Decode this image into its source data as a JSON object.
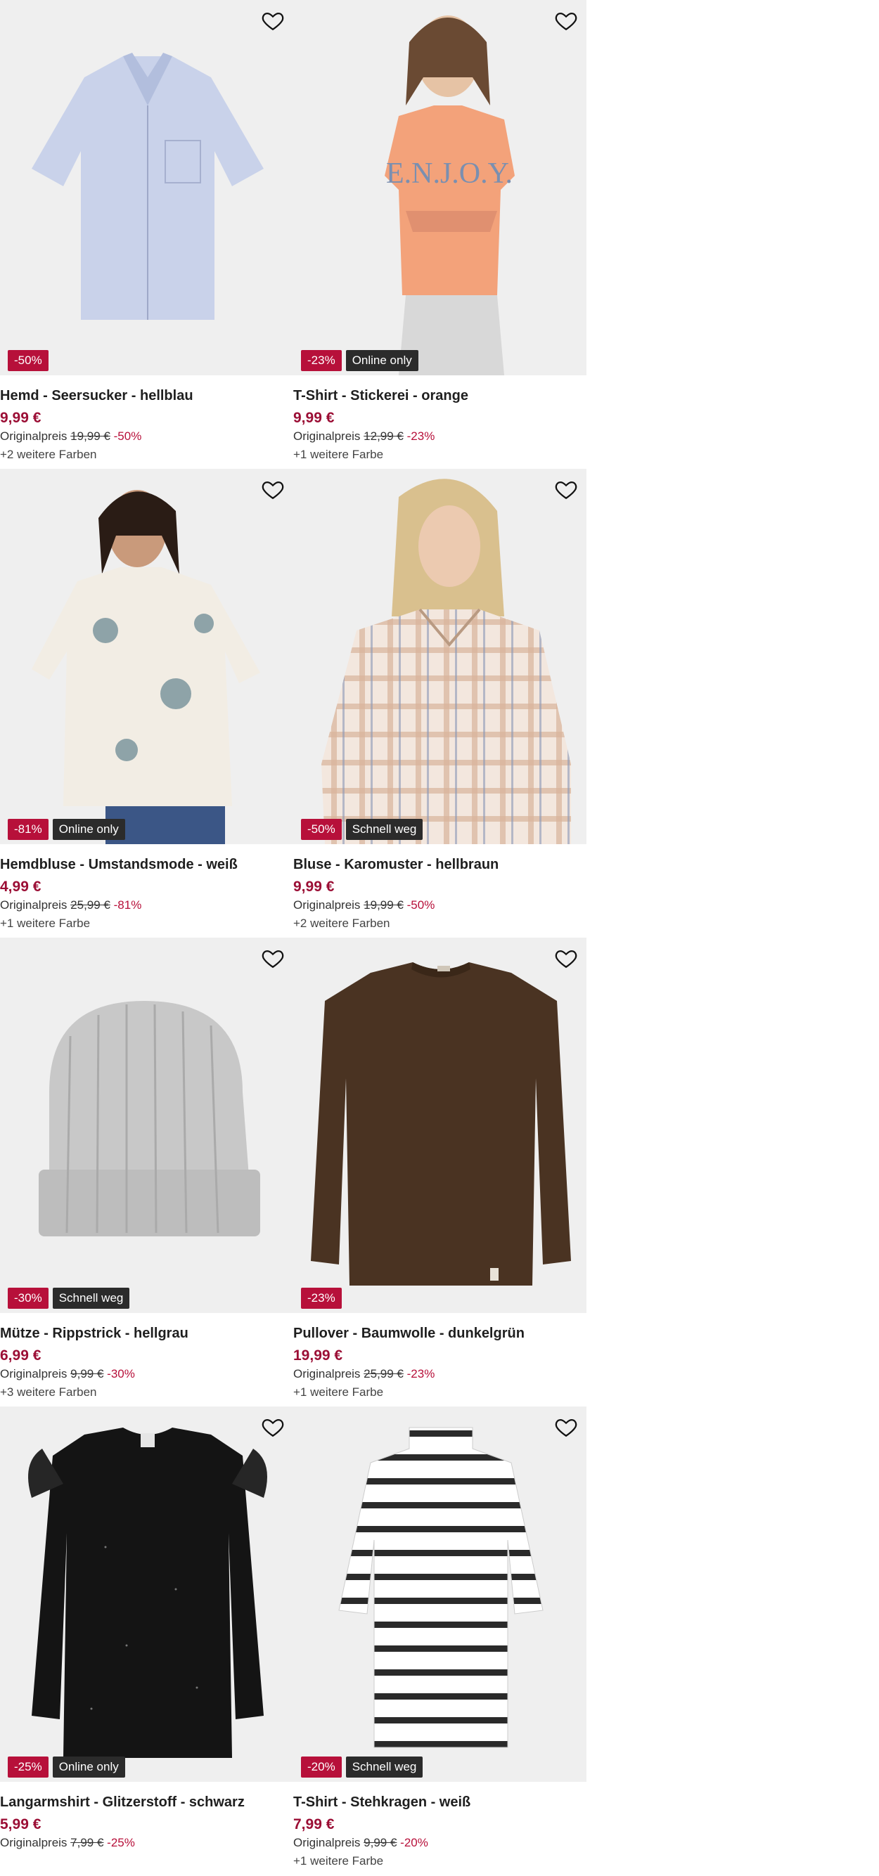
{
  "products": [
    {
      "title": "Hemd - Seersucker - hellblau",
      "price": "9,99 €",
      "orig_label": "Originalpreis",
      "orig_price": "19,99 €",
      "discount": "-50%",
      "colors": "+2 weitere Farben",
      "badges": [
        "-50%"
      ]
    },
    {
      "title": "T-Shirt - Stickerei - orange",
      "price": "9,99 €",
      "orig_label": "Originalpreis",
      "orig_price": "12,99 €",
      "discount": "-23%",
      "colors": "+1 weitere Farbe",
      "badges": [
        "-23%",
        "Online only"
      ],
      "print": "E.N.J.O.Y."
    },
    {
      "title": "Hemdbluse - Umstandsmode - weiß",
      "price": "4,99 €",
      "orig_label": "Originalpreis",
      "orig_price": "25,99 €",
      "discount": "-81%",
      "colors": "+1 weitere Farbe",
      "badges": [
        "-81%",
        "Online only"
      ]
    },
    {
      "title": "Bluse - Karomuster - hellbraun",
      "price": "9,99 €",
      "orig_label": "Originalpreis",
      "orig_price": "19,99 €",
      "discount": "-50%",
      "colors": "+2 weitere Farben",
      "badges": [
        "-50%",
        "Schnell weg"
      ]
    },
    {
      "title": "Mütze - Rippstrick - hellgrau",
      "price": "6,99 €",
      "orig_label": "Originalpreis",
      "orig_price": "9,99 €",
      "discount": "-30%",
      "colors": "+3 weitere Farben",
      "badges": [
        "-30%",
        "Schnell weg"
      ]
    },
    {
      "title": "Pullover - Baumwolle - dunkelgrün",
      "price": "19,99 €",
      "orig_label": "Originalpreis",
      "orig_price": "25,99 €",
      "discount": "-23%",
      "colors": "+1 weitere Farbe",
      "badges": [
        "-23%"
      ]
    },
    {
      "title": "Langarmshirt - Glitzerstoff - schwarz",
      "price": "5,99 €",
      "orig_label": "Originalpreis",
      "orig_price": "7,99 €",
      "discount": "-25%",
      "colors": "",
      "badges": [
        "-25%",
        "Online only"
      ]
    },
    {
      "title": "T-Shirt - Stehkragen - weiß",
      "price": "7,99 €",
      "orig_label": "Originalpreis",
      "orig_price": "9,99 €",
      "discount": "-20%",
      "colors": "+1 weitere Farbe",
      "badges": [
        "-20%",
        "Schnell weg"
      ]
    }
  ],
  "icons": {
    "wishlist": "heart-outline-icon"
  },
  "colors": {
    "sale_badge": "#b7103a",
    "dark_badge": "#2b2b2b",
    "price": "#9b0e35",
    "image_bg": "#efefef"
  }
}
